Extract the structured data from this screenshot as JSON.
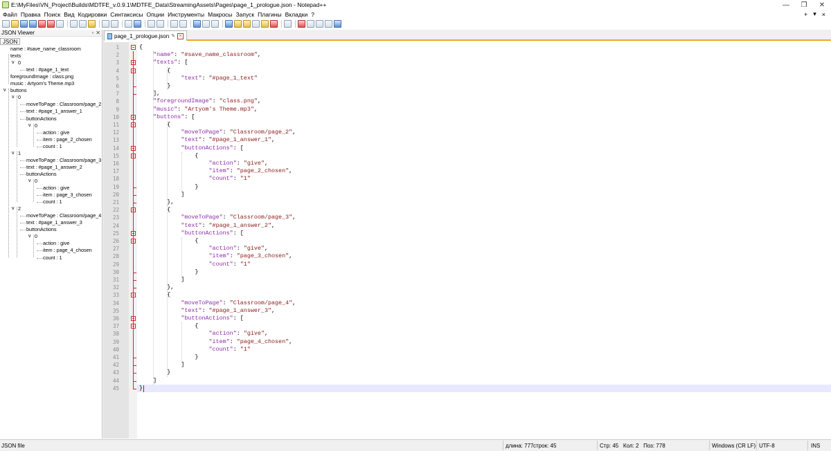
{
  "window": {
    "title": "E:\\MyFiles\\VN_Project\\Builds\\MDTFE_v.0.9.1\\MDTFE_Data\\StreamingAssets\\Pages\\page_1_prologue.json - Notepad++"
  },
  "menubar": {
    "items": [
      "Файл",
      "Правка",
      "Поиск",
      "Вид",
      "Кодировки",
      "Синтаксисы",
      "Опции",
      "Инструменты",
      "Макросы",
      "Запуск",
      "Плагины",
      "Вкладки",
      "?"
    ],
    "right": [
      "+",
      "▾",
      "×"
    ]
  },
  "json_viewer": {
    "title": "JSON Viewer",
    "tab": "JSON",
    "nodes": [
      {
        "label": "name : #save_name_classroom",
        "depth": 1,
        "expander": ""
      },
      {
        "label": "texts",
        "depth": 1,
        "expander": ""
      },
      {
        "label": "0",
        "depth": 2,
        "expander": "v"
      },
      {
        "label": "text : #page_1_text",
        "depth": 3,
        "expander": ""
      },
      {
        "label": "foregroundImage : class.png",
        "depth": 1,
        "expander": ""
      },
      {
        "label": "music : Artyom's Theme.mp3",
        "depth": 1,
        "expander": ""
      },
      {
        "label": "buttons",
        "depth": 1,
        "expander": "v"
      },
      {
        "label": "0",
        "depth": 2,
        "expander": "v"
      },
      {
        "label": "moveToPage : Classroom/page_2",
        "depth": 3,
        "expander": ""
      },
      {
        "label": "text : #page_1_answer_1",
        "depth": 3,
        "expander": ""
      },
      {
        "label": "buttonActions",
        "depth": 3,
        "expander": ""
      },
      {
        "label": "0",
        "depth": 4,
        "expander": "v"
      },
      {
        "label": "action : give",
        "depth": 5,
        "expander": ""
      },
      {
        "label": "item : page_2_chosen",
        "depth": 5,
        "expander": ""
      },
      {
        "label": "count : 1",
        "depth": 5,
        "expander": ""
      },
      {
        "label": "1",
        "depth": 2,
        "expander": "v"
      },
      {
        "label": "moveToPage : Classroom/page_3",
        "depth": 3,
        "expander": ""
      },
      {
        "label": "text : #page_1_answer_2",
        "depth": 3,
        "expander": ""
      },
      {
        "label": "buttonActions",
        "depth": 3,
        "expander": ""
      },
      {
        "label": "0",
        "depth": 4,
        "expander": "v"
      },
      {
        "label": "action : give",
        "depth": 5,
        "expander": ""
      },
      {
        "label": "item : page_3_chosen",
        "depth": 5,
        "expander": ""
      },
      {
        "label": "count : 1",
        "depth": 5,
        "expander": ""
      },
      {
        "label": "2",
        "depth": 2,
        "expander": "v"
      },
      {
        "label": "moveToPage : Classroom/page_4",
        "depth": 3,
        "expander": ""
      },
      {
        "label": "text : #page_1_answer_3",
        "depth": 3,
        "expander": ""
      },
      {
        "label": "buttonActions",
        "depth": 3,
        "expander": ""
      },
      {
        "label": "0",
        "depth": 4,
        "expander": "v"
      },
      {
        "label": "action : give",
        "depth": 5,
        "expander": ""
      },
      {
        "label": "item : page_4_chosen",
        "depth": 5,
        "expander": ""
      },
      {
        "label": "count : 1",
        "depth": 5,
        "expander": ""
      }
    ]
  },
  "editor": {
    "tab_label": "page_1_prologue.json",
    "current_line": 45,
    "lines": [
      [
        [
          "p",
          "{"
        ]
      ],
      [
        [
          "p",
          "    "
        ],
        [
          "k",
          "\"name\""
        ],
        [
          "p",
          ": "
        ],
        [
          "s",
          "\"#save_name_classroom\""
        ],
        [
          "p",
          ","
        ]
      ],
      [
        [
          "p",
          "    "
        ],
        [
          "k",
          "\"texts\""
        ],
        [
          "p",
          ": ["
        ]
      ],
      [
        [
          "p",
          "        {"
        ]
      ],
      [
        [
          "p",
          "            "
        ],
        [
          "k",
          "\"text\""
        ],
        [
          "p",
          ": "
        ],
        [
          "s",
          "\"#page_1_text\""
        ]
      ],
      [
        [
          "p",
          "        }"
        ]
      ],
      [
        [
          "p",
          "    ],"
        ]
      ],
      [
        [
          "p",
          "    "
        ],
        [
          "k",
          "\"foregroundImage\""
        ],
        [
          "p",
          ": "
        ],
        [
          "s",
          "\"class.png\""
        ],
        [
          "p",
          ","
        ]
      ],
      [
        [
          "p",
          "    "
        ],
        [
          "k",
          "\"music\""
        ],
        [
          "p",
          ": "
        ],
        [
          "s",
          "\"Artyom's Theme.mp3\""
        ],
        [
          "p",
          ","
        ]
      ],
      [
        [
          "p",
          "    "
        ],
        [
          "k",
          "\"buttons\""
        ],
        [
          "p",
          ": ["
        ]
      ],
      [
        [
          "p",
          "        {"
        ]
      ],
      [
        [
          "p",
          "            "
        ],
        [
          "k",
          "\"moveToPage\""
        ],
        [
          "p",
          ": "
        ],
        [
          "s",
          "\"Classroom/page_2\""
        ],
        [
          "p",
          ","
        ]
      ],
      [
        [
          "p",
          "            "
        ],
        [
          "k",
          "\"text\""
        ],
        [
          "p",
          ": "
        ],
        [
          "s",
          "\"#page_1_answer_1\""
        ],
        [
          "p",
          ","
        ]
      ],
      [
        [
          "p",
          "            "
        ],
        [
          "k",
          "\"buttonActions\""
        ],
        [
          "p",
          ": ["
        ]
      ],
      [
        [
          "p",
          "                {"
        ]
      ],
      [
        [
          "p",
          "                    "
        ],
        [
          "k",
          "\"action\""
        ],
        [
          "p",
          ": "
        ],
        [
          "s",
          "\"give\""
        ],
        [
          "p",
          ","
        ]
      ],
      [
        [
          "p",
          "                    "
        ],
        [
          "k",
          "\"item\""
        ],
        [
          "p",
          ": "
        ],
        [
          "s",
          "\"page_2_chosen\""
        ],
        [
          "p",
          ","
        ]
      ],
      [
        [
          "p",
          "                    "
        ],
        [
          "k",
          "\"count\""
        ],
        [
          "p",
          ": "
        ],
        [
          "s",
          "\"1\""
        ]
      ],
      [
        [
          "p",
          "                }"
        ]
      ],
      [
        [
          "p",
          "            ]"
        ]
      ],
      [
        [
          "p",
          "        },"
        ]
      ],
      [
        [
          "p",
          "        {"
        ]
      ],
      [
        [
          "p",
          "            "
        ],
        [
          "k",
          "\"moveToPage\""
        ],
        [
          "p",
          ": "
        ],
        [
          "s",
          "\"Classroom/page_3\""
        ],
        [
          "p",
          ","
        ]
      ],
      [
        [
          "p",
          "            "
        ],
        [
          "k",
          "\"text\""
        ],
        [
          "p",
          ": "
        ],
        [
          "s",
          "\"#page_1_answer_2\""
        ],
        [
          "p",
          ","
        ]
      ],
      [
        [
          "p",
          "            "
        ],
        [
          "k",
          "\"buttonActions\""
        ],
        [
          "p",
          ": ["
        ]
      ],
      [
        [
          "p",
          "                {"
        ]
      ],
      [
        [
          "p",
          "                    "
        ],
        [
          "k",
          "\"action\""
        ],
        [
          "p",
          ": "
        ],
        [
          "s",
          "\"give\""
        ],
        [
          "p",
          ","
        ]
      ],
      [
        [
          "p",
          "                    "
        ],
        [
          "k",
          "\"item\""
        ],
        [
          "p",
          ": "
        ],
        [
          "s",
          "\"page_3_chosen\""
        ],
        [
          "p",
          ","
        ]
      ],
      [
        [
          "p",
          "                    "
        ],
        [
          "k",
          "\"count\""
        ],
        [
          "p",
          ": "
        ],
        [
          "s",
          "\"1\""
        ]
      ],
      [
        [
          "p",
          "                }"
        ]
      ],
      [
        [
          "p",
          "            ]"
        ]
      ],
      [
        [
          "p",
          "        },"
        ]
      ],
      [
        [
          "p",
          "        {"
        ]
      ],
      [
        [
          "p",
          "            "
        ],
        [
          "k",
          "\"moveToPage\""
        ],
        [
          "p",
          ": "
        ],
        [
          "s",
          "\"Classroom/page_4\""
        ],
        [
          "p",
          ","
        ]
      ],
      [
        [
          "p",
          "            "
        ],
        [
          "k",
          "\"text\""
        ],
        [
          "p",
          ": "
        ],
        [
          "s",
          "\"#page_1_answer_3\""
        ],
        [
          "p",
          ","
        ]
      ],
      [
        [
          "p",
          "            "
        ],
        [
          "k",
          "\"buttonActions\""
        ],
        [
          "p",
          ": ["
        ]
      ],
      [
        [
          "p",
          "                {"
        ]
      ],
      [
        [
          "p",
          "                    "
        ],
        [
          "k",
          "\"action\""
        ],
        [
          "p",
          ": "
        ],
        [
          "s",
          "\"give\""
        ],
        [
          "p",
          ","
        ]
      ],
      [
        [
          "p",
          "                    "
        ],
        [
          "k",
          "\"item\""
        ],
        [
          "p",
          ": "
        ],
        [
          "s",
          "\"page_4_chosen\""
        ],
        [
          "p",
          ","
        ]
      ],
      [
        [
          "p",
          "                    "
        ],
        [
          "k",
          "\"count\""
        ],
        [
          "p",
          ": "
        ],
        [
          "s",
          "\"1\""
        ]
      ],
      [
        [
          "p",
          "                }"
        ]
      ],
      [
        [
          "p",
          "            ]"
        ]
      ],
      [
        [
          "p",
          "        }"
        ]
      ],
      [
        [
          "p",
          "    ]"
        ]
      ],
      [
        [
          "p",
          "}"
        ]
      ]
    ]
  },
  "statusbar": {
    "file_type": "JSON file",
    "length": "длина: 777",
    "lines": "строк: 45",
    "position": "Стр: 45   Кол: 2   Поз: 778",
    "eol": "Windows (CR LF)",
    "encoding": "UTF-8",
    "mode": "INS"
  },
  "colors": {
    "key": "#8b2ca8",
    "string": "#8b1a1a",
    "fold_marker": "#dd2222",
    "tab_accent": "#f5a623",
    "current_line": "#e8e8ff"
  }
}
